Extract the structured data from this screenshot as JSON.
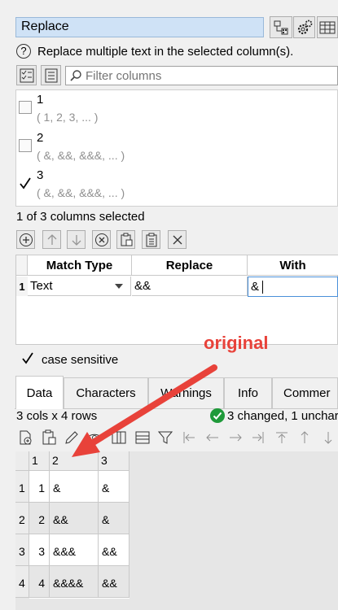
{
  "header": {
    "title": "Replace",
    "help_text": "Replace multiple text in the selected column(s).",
    "icons": [
      "connection-icon",
      "settings-gear-icon",
      "table-icon"
    ]
  },
  "filter": {
    "placeholder": "Filter columns"
  },
  "columns": [
    {
      "name": "1",
      "sample": "( 1, 2, 3, ... )",
      "checked": false
    },
    {
      "name": "2",
      "sample": "( &, &&, &&&, ... )",
      "checked": false
    },
    {
      "name": "3",
      "sample": "( &, &&, &&&, ... )",
      "checked": true
    }
  ],
  "selection_status": "1 of 3 columns selected",
  "match_table": {
    "headers": [
      "Match Type",
      "Replace",
      "With"
    ],
    "rows": [
      {
        "num": "1",
        "match_type": "Text",
        "replace": "&&",
        "with": "&"
      }
    ]
  },
  "case_sensitive": {
    "label": "case sensitive",
    "checked": true
  },
  "tabs": [
    "Data",
    "Characters",
    "Warnings",
    "Info",
    "Commer"
  ],
  "active_tab": "Data",
  "data_info": {
    "dims": "3 cols x 4 rows",
    "status": "3 changed, 1 unchar"
  },
  "grid": {
    "headers": [
      "1",
      "2",
      "3"
    ],
    "rows": [
      {
        "num": "1",
        "c1": "1",
        "c2": "&",
        "c3": "&"
      },
      {
        "num": "2",
        "c1": "2",
        "c2": "&&",
        "c3": "&"
      },
      {
        "num": "3",
        "c1": "3",
        "c2": "&&&",
        "c3": "&&"
      },
      {
        "num": "4",
        "c1": "4",
        "c2": "&&&&",
        "c3": "&&"
      }
    ]
  },
  "annotation": {
    "text": "original",
    "color": "#e8423a"
  }
}
